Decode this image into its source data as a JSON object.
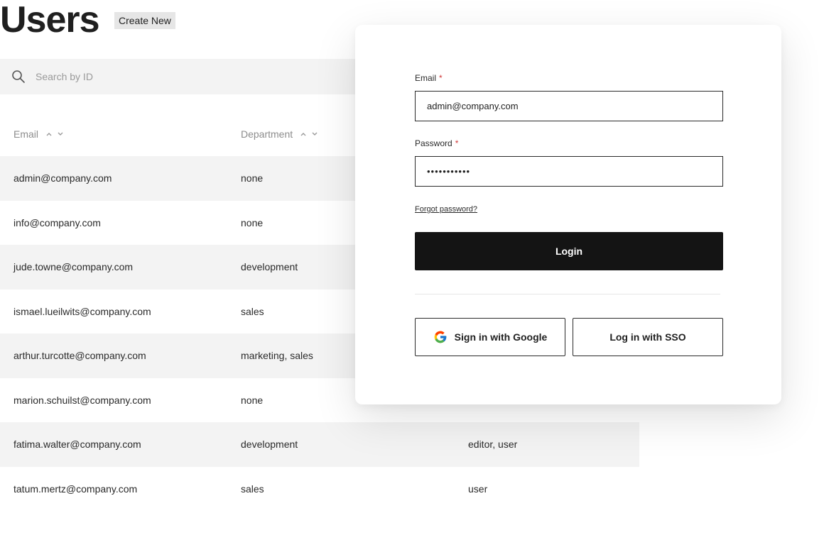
{
  "header": {
    "title": "Users",
    "create_label": "Create New"
  },
  "search": {
    "placeholder": "Search by ID",
    "icon": "search-icon"
  },
  "table": {
    "columns": [
      "Email",
      "Department"
    ],
    "rows": [
      {
        "email": "admin@company.com",
        "department": "none",
        "roles": ""
      },
      {
        "email": "info@company.com",
        "department": "none",
        "roles": ""
      },
      {
        "email": "jude.towne@company.com",
        "department": "development",
        "roles": ""
      },
      {
        "email": "ismael.lueilwits@company.com",
        "department": "sales",
        "roles": ""
      },
      {
        "email": "arthur.turcotte@company.com",
        "department": "marketing, sales",
        "roles": ""
      },
      {
        "email": "marion.schuilst@company.com",
        "department": "none",
        "roles": ""
      },
      {
        "email": "fatima.walter@company.com",
        "department": "development",
        "roles": "editor, user"
      },
      {
        "email": "tatum.mertz@company.com",
        "department": "sales",
        "roles": "user"
      }
    ]
  },
  "login": {
    "email_label": "Email",
    "email_value": "admin@company.com",
    "password_label": "Password",
    "password_value": "•••••••••••",
    "required_mark": "*",
    "forgot_label": "Forgot password?",
    "login_label": "Login",
    "google_label": "Sign in with Google",
    "sso_label": "Log in with SSO"
  },
  "colors": {
    "primary_button": "#141414",
    "required": "#d03a3a",
    "row_alt": "#f3f3f3"
  }
}
